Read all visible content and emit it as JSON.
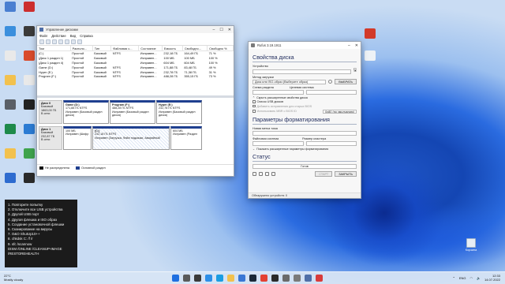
{
  "desktop": {
    "icons": [
      {
        "label": "",
        "color": "#4a7fd1"
      },
      {
        "label": "",
        "color": "#3b8fdd"
      },
      {
        "label": "",
        "color": "#e9e9e9"
      },
      {
        "label": "",
        "color": "#f2c14e"
      },
      {
        "label": "",
        "color": "#5a5f66"
      },
      {
        "label": "",
        "color": "#1e8a4a"
      },
      {
        "label": "",
        "color": "#f2c14e"
      },
      {
        "label": "",
        "color": "#2d6bcf"
      },
      {
        "label": "",
        "color": "#cc2e2e"
      },
      {
        "label": "",
        "color": "#3b3b3b"
      },
      {
        "label": "",
        "color": "#d94b2b"
      },
      {
        "label": "",
        "color": "#e9e9e9"
      },
      {
        "label": "",
        "color": "#222222"
      },
      {
        "label": "",
        "color": "#2b7bd3"
      },
      {
        "label": "",
        "color": "#3fa34d"
      },
      {
        "label": "",
        "color": "#2a2a2a"
      }
    ],
    "right_icons": [
      {
        "label": "",
        "color": "#d23a2a"
      },
      {
        "label": "",
        "color": "#eef2f6"
      }
    ],
    "recycle_bin_label": "Корзина"
  },
  "disk_mgmt": {
    "title": "Управление дисками",
    "menu": [
      "Файл",
      "Действие",
      "Вид",
      "Справка"
    ],
    "columns": [
      "Том",
      "Располо...",
      "Тип",
      "Файловая с...",
      "Состояние",
      "Емкость",
      "Свободно...",
      "Свободно %"
    ],
    "rows": [
      [
        "(C:)",
        "Простой",
        "Базовый",
        "NTFS",
        "Исправен...",
        "232,18 ГБ",
        "164,49 ГБ",
        "71 %"
      ],
      [
        "(Диск 1 раздел 1)",
        "Простой",
        "Базовый",
        "",
        "Исправен...",
        "100 МБ",
        "100 МБ",
        "100 %"
      ],
      [
        "(Диск 1 раздел 4)",
        "Простой",
        "Базовый",
        "",
        "Исправен...",
        "604 МБ",
        "604 МБ",
        "100 %"
      ],
      [
        "Game (D:)",
        "Простой",
        "Базовый",
        "NTFS",
        "Исправен...",
        "171,88 ГБ",
        "83,48 ГБ",
        "49 %"
      ],
      [
        "Hyper (E:)",
        "Простой",
        "Базовый",
        "NTFS",
        "Исправен...",
        "232,78 ГБ",
        "71,38 ГБ",
        "31 %"
      ],
      [
        "Program (F:)",
        "Простой",
        "Базовый",
        "NTFS",
        "Исправен...",
        "488,28 ГБ",
        "355,15 ГБ",
        "73 %"
      ]
    ],
    "disks": [
      {
        "name": "Диск 0",
        "type": "Базовый",
        "size": "1863,00 ГБ",
        "status": "В сети",
        "parts": [
          {
            "name": "Game (D:)",
            "size": "171,88 ГБ NTFS",
            "status": "Исправен (Базовый раздел диска)",
            "hatch": false
          },
          {
            "name": "Program (F:)",
            "size": "488,28 ГБ NTFS",
            "status": "Исправен (Базовый раздел диска)",
            "hatch": false
          },
          {
            "name": "Hyper (E:)",
            "size": "232,78 ГБ NTFS",
            "status": "Исправен (Базовый раздел диска)",
            "hatch": false
          }
        ]
      },
      {
        "name": "Диск 1",
        "type": "Базовый",
        "size": "232,87 ГБ",
        "status": "В сети",
        "parts": [
          {
            "name": "",
            "size": "100 МБ",
            "status": "Исправен (Шифр",
            "hatch": false
          },
          {
            "name": "(C:)",
            "size": "232,18 ГБ NTFS",
            "status": "Исправен (Загрузка, Файл подкачки, Аварийный",
            "hatch": true
          },
          {
            "name": "",
            "size": "604 МБ",
            "status": "Исправен (Раздел",
            "hatch": false
          }
        ]
      }
    ],
    "legend": [
      {
        "label": "Не распределена",
        "color": "#111111"
      },
      {
        "label": "Основной раздел",
        "color": "#1f3f8f"
      }
    ]
  },
  "rufus": {
    "title": "Rufus 3.19.1911",
    "device_props_heading": "Свойства диска",
    "device_label": "Устройство",
    "device_value": "",
    "boot_label": "Метод загрузки",
    "boot_value": "Диск или ISO-образ (Выберите образ)",
    "select_button": "ВЫБРАТЬ",
    "partition_label": "Схема раздела",
    "target_label": "Целевая система",
    "adv_hide": "Скрыть расширенные свойства диска",
    "list_usb": "Список USB дисков",
    "fix_bios": "Добавить исправления для старых BIOS",
    "mbr_bios": "Использовать MBR с BIOS ID",
    "mbr_value": "0x80 (по умолчанию)",
    "format_heading": "Параметры форматирования",
    "volume_label": "Новая метка тома",
    "fs_label": "Файловая система",
    "cluster_label": "Размер кластера",
    "show_adv_format": "Показать расширенные параметры форматирования",
    "status_heading": "Статус",
    "status_text": "Готов",
    "start_button": "СТАРТ",
    "close_button": "ЗАКРЫТЬ",
    "footer": "Обнаружено устройств: 0",
    "progress": 0
  },
  "cmd_steps": [
    "1. Повторите попытку",
    "2. Отключите все USB устройства",
    "3. Другой USB порт",
    "4. Другая флешка и ISO образ",
    "5. Создание установочной флешки",
    "6. Сканирование на вирусы",
    "7. O&O ShutUp10++",
    "8. chkdsk C: /f /r",
    "9. sfc /scannow",
    "DISM /ONLINE /CLEANUP-IMAGE",
    "/RESTOREHEALTH"
  ],
  "taskbar": {
    "weather_temp": "22°C",
    "weather_text": "Mostly cloudy",
    "lang": "ENG",
    "time": "12:33",
    "date": "14.07.2022",
    "apps": [
      {
        "name": "start",
        "color": "#1f6fe0"
      },
      {
        "name": "search",
        "color": "#5a5a5a"
      },
      {
        "name": "task-view",
        "color": "#3a3a3a"
      },
      {
        "name": "widgets",
        "color": "#2d8fe8"
      },
      {
        "name": "edge",
        "color": "#1b9de2"
      },
      {
        "name": "explorer",
        "color": "#f2c14e"
      },
      {
        "name": "store",
        "color": "#3a77d4"
      },
      {
        "name": "steam",
        "color": "#1b2838"
      },
      {
        "name": "chrome",
        "color": "#e34133"
      },
      {
        "name": "terminal",
        "color": "#2a2a2a"
      },
      {
        "name": "settings",
        "color": "#6a6a6a"
      },
      {
        "name": "rufus",
        "color": "#7a7a7a"
      },
      {
        "name": "disk",
        "color": "#4f6fa8"
      },
      {
        "name": "media",
        "color": "#d83b3b"
      }
    ]
  }
}
